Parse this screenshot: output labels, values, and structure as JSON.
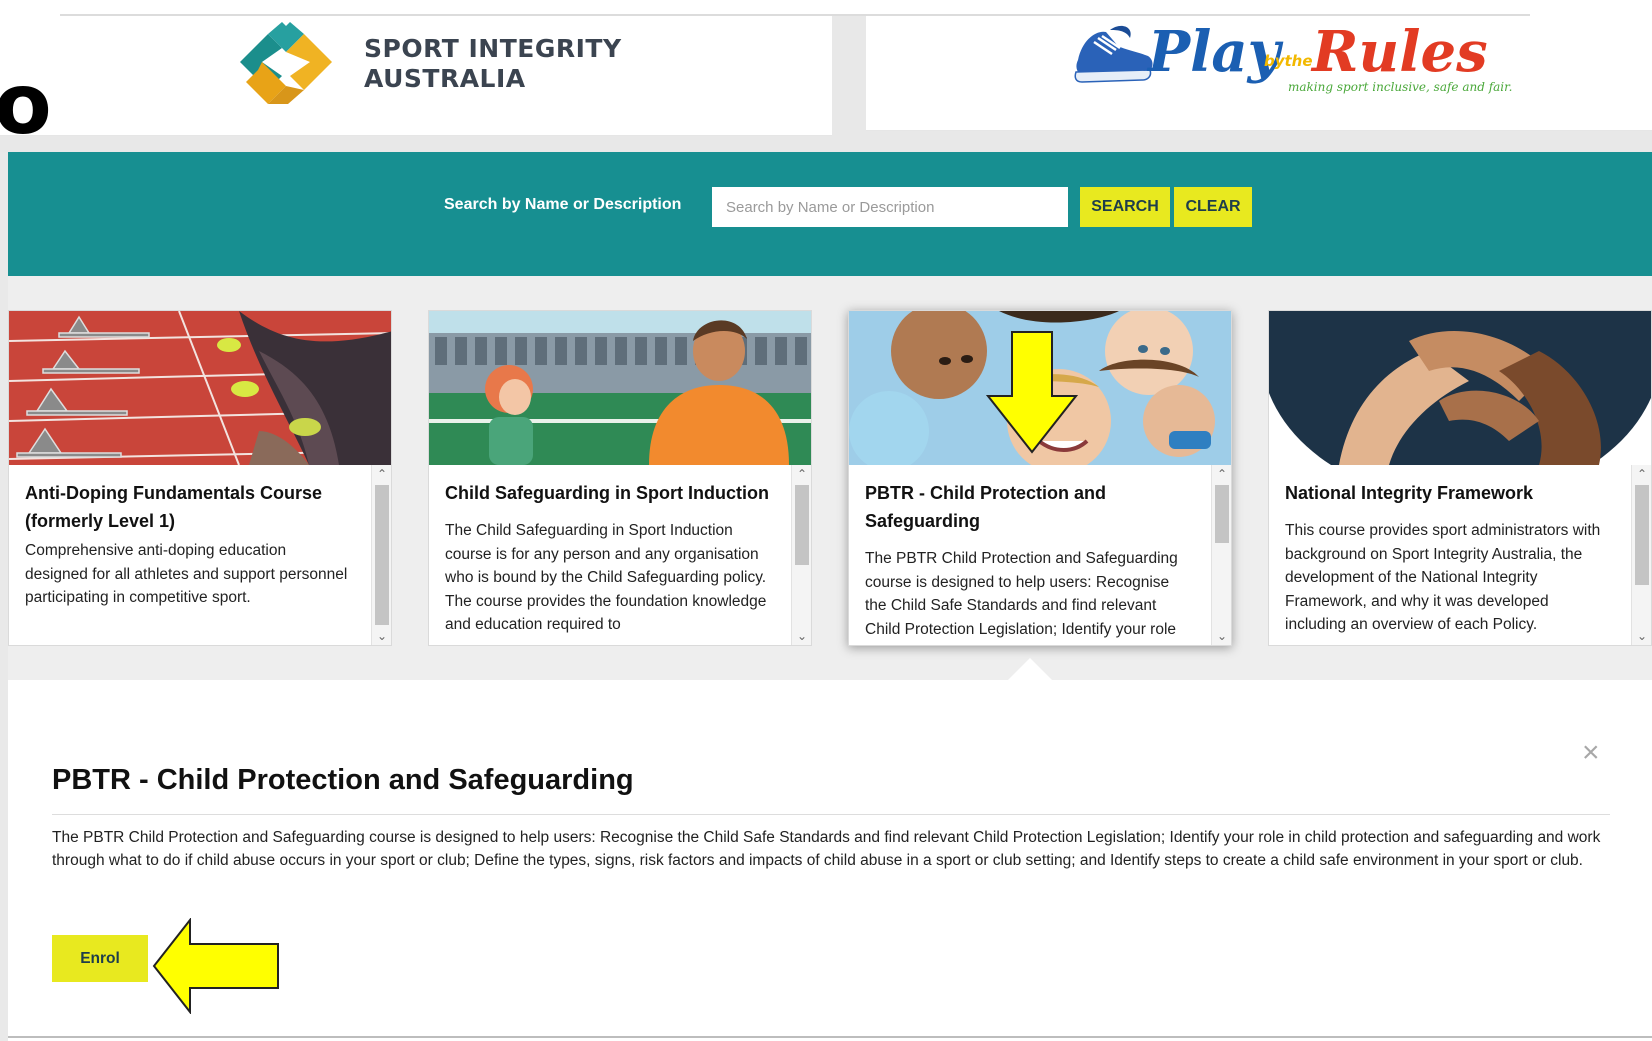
{
  "header": {
    "partial_heading": "o",
    "left_logo": {
      "icon": "sport-integrity-diamond-icon",
      "line1": "SPORT INTEGRITY",
      "line2": "AUSTRALIA"
    },
    "right_logo": {
      "icon": "sneaker-icon",
      "word_play": "Play",
      "word_by_the": "bythe",
      "word_rules": "Rules",
      "tagline": "making sport inclusive, safe and fair."
    }
  },
  "search": {
    "label": "Search by Name or Description",
    "placeholder": "Search by Name or Description",
    "value": "",
    "search_label": "SEARCH",
    "clear_label": "CLEAR"
  },
  "cards": [
    {
      "title": "Anti-Doping Fundamentals Course (formerly Level 1)",
      "description": "Comprehensive anti-doping education designed for all athletes and support personnel participating in competitive sport."
    },
    {
      "title": "Child Safeguarding in Sport Induction",
      "description": "The Child Safeguarding in Sport Induction course is for any person and any organisation who is bound by the Child Safeguarding policy. The course provides the foundation knowledge and education required to"
    },
    {
      "title": "PBTR - Child Protection and Safeguarding",
      "description": "The PBTR Child Protection and Safeguarding course is designed to help users: Recognise the Child Safe Standards and find relevant Child Protection Legislation; Identify your role",
      "selected": true
    },
    {
      "title": "National Integrity Framework",
      "description": "This course provides sport administrators with background on Sport Integrity Australia, the development of the National Integrity Framework, and why it was developed including an overview of each Policy."
    }
  ],
  "detail": {
    "title": "PBTR - Child Protection and Safeguarding",
    "description": "The PBTR Child Protection and Safeguarding course is designed to help users: Recognise the Child Safe Standards and find relevant Child Protection Legislation; Identify your role in child protection and safeguarding and work through what to do if child abuse occurs in your sport or club; Define the types, signs, risk factors and impacts of child abuse in a sport or club setting; and Identify steps to create a child safe environment in your sport or club.",
    "close_glyph": "×",
    "enrol_label": "Enrol"
  },
  "colors": {
    "teal_band": "#178f91",
    "button_yellow": "#e8e91f",
    "annotation_arrow": "#ffff00"
  }
}
